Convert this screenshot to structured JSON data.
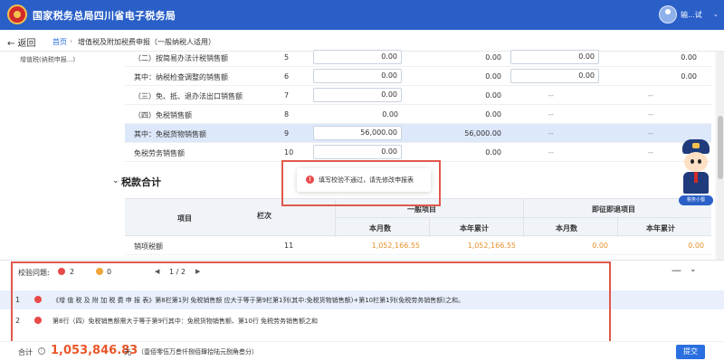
{
  "header": {
    "site_title": "国家税务总局四川省电子税务局",
    "user_name": "输...试",
    "user_caret": "⌄"
  },
  "breadcrumb": {
    "back_label": "← 返回",
    "home": "首页",
    "separator": "›",
    "page": "增值税及附加税费申报（一般纳税人适用）"
  },
  "sidebar": {
    "item": "增值税(纳税申报...)"
  },
  "form_rows": [
    {
      "name": "（二）按简易办法计税销售额",
      "num": "5",
      "c1": "0.00",
      "c2": "0.00",
      "c3": "0.00",
      "c4": "0.00"
    },
    {
      "name": "其中：纳税检查调整的销售额",
      "num": "6",
      "c1": "0.00",
      "c2": "0.00",
      "c3": "0.00",
      "c4": "0.00"
    },
    {
      "name": "（三）免、抵、退办法出口销售额",
      "num": "7",
      "c1": "0.00",
      "c2": "0.00",
      "c3": "--",
      "c4": "--"
    },
    {
      "name": "（四）免税销售额",
      "num": "8",
      "c1": "0.00",
      "c2": "0.00",
      "c3": "--",
      "c4": "--"
    },
    {
      "name": "其中：免税货物销售额",
      "num": "9",
      "c1": "56,000.00",
      "c2": "56,000.00",
      "c3": "--",
      "c4": "--"
    },
    {
      "name": "免税劳务销售额",
      "num": "10",
      "c1": "0.00",
      "c2": "0.00",
      "c3": "--",
      "c4": "--"
    }
  ],
  "tax_section": {
    "title": "税款合计",
    "chevron": "⌄",
    "col_item": "项目",
    "col_num": "栏次",
    "col_general": "一般项目",
    "col_immediate": "即征即退项目",
    "col_month": "本月数",
    "col_year": "本年累计",
    "col_month2": "本月数",
    "col_year2": "本年累计",
    "row_name": "销项税额",
    "row_num": "11",
    "row_v1": "1,052,166.55",
    "row_v2": "1,052,166.55",
    "row_v3": "0.00",
    "row_v4": "0.00"
  },
  "mascot": {
    "tag": "税务小蜀"
  },
  "toast": {
    "icon": "!",
    "message": "填写校验不通过，请先修改申报表"
  },
  "validation": {
    "label": "校验问题:",
    "error_count": "2",
    "warning_count": "0",
    "prev": "◀",
    "page": "1 / 2",
    "next": "▶",
    "minimize": "—",
    "collapse": "⌄",
    "items": [
      {
        "index": "1",
        "message": "《增 值 税 及 附 加 税 费 申 报 表》第8栏第1列 免税销售额 应大于等于第9栏第1列(其中:免税货物销售额)+第10栏第1列(免税劳务销售额)之和。"
      },
      {
        "index": "2",
        "message": "第8行（四）免税销售额需大于等于第9行其中：免税货物销售额、第10行 免税劳务销售额之和"
      }
    ]
  },
  "footer": {
    "total_label": "合计",
    "info_icon": "i",
    "total_value": "1,053,846.83",
    "unit": "元",
    "amount_words": "（壹佰零伍万叁仟捌佰肆拾陆元捌角叁分）",
    "submit": "提交"
  },
  "colors": {
    "header_bg": "#2a5fc8",
    "highlight_row": "#dde8fb",
    "orange_value": "#e8912a",
    "error_red": "#e84a4a",
    "warning_orange": "#f0a63a",
    "annotation_red": "#e0584c",
    "primary_button": "#2a6fe0"
  }
}
